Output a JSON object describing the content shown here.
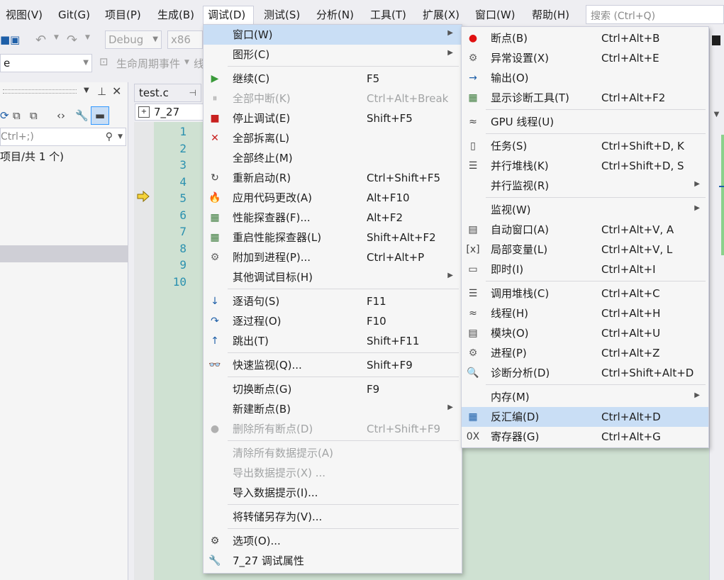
{
  "menubar": {
    "items": [
      "视图(V)",
      "Git(G)",
      "项目(P)",
      "生成(B)",
      "调试(D)",
      "测试(S)",
      "分析(N)",
      "工具(T)",
      "扩展(X)",
      "窗口(W)",
      "帮助(H)"
    ],
    "search_placeholder": "搜索 (Ctrl+Q)"
  },
  "toolbar": {
    "config": "Debug",
    "platform": "x86",
    "left_combo": "e",
    "lifecycle": "生命周期事件",
    "lifecycle_trail": "线"
  },
  "left_panel": {
    "search_placeholder": "Ctrl+;)",
    "solution_text": "项目/共 1 个)"
  },
  "editor": {
    "tab_title": "test.c",
    "tab_pin": "⊣",
    "scope": "7_27",
    "line_numbers": [
      "1",
      "2",
      "3",
      "4",
      "5",
      "6",
      "7",
      "8",
      "9",
      "10"
    ]
  },
  "debug_menu": {
    "items": [
      {
        "icon": "",
        "label": "窗口(W)",
        "shortcut": "",
        "submenu": true
      },
      {
        "icon": "",
        "label": "图形(C)",
        "shortcut": "",
        "submenu": true
      },
      {
        "icon": "▶",
        "label": "继续(C)",
        "shortcut": "F5"
      },
      {
        "icon": "⏸",
        "label": "全部中断(K)",
        "shortcut": "Ctrl+Alt+Break",
        "disabled": true
      },
      {
        "icon": "■",
        "label": "停止调试(E)",
        "shortcut": "Shift+F5"
      },
      {
        "icon": "✕",
        "label": "全部拆离(L)",
        "shortcut": ""
      },
      {
        "icon": "",
        "label": "全部终止(M)",
        "shortcut": ""
      },
      {
        "icon": "↻",
        "label": "重新启动(R)",
        "shortcut": "Ctrl+Shift+F5"
      },
      {
        "icon": "🔥",
        "label": "应用代码更改(A)",
        "shortcut": "Alt+F10"
      },
      {
        "icon": "▦",
        "label": "性能探查器(F)...",
        "shortcut": "Alt+F2"
      },
      {
        "icon": "▦",
        "label": "重启性能探查器(L)",
        "shortcut": "Shift+Alt+F2"
      },
      {
        "icon": "⚙",
        "label": "附加到进程(P)...",
        "shortcut": "Ctrl+Alt+P"
      },
      {
        "icon": "",
        "label": "其他调试目标(H)",
        "shortcut": "",
        "submenu": true
      },
      {
        "icon": "↓",
        "label": "逐语句(S)",
        "shortcut": "F11"
      },
      {
        "icon": "↷",
        "label": "逐过程(O)",
        "shortcut": "F10"
      },
      {
        "icon": "↑",
        "label": "跳出(T)",
        "shortcut": "Shift+F11"
      },
      {
        "icon": "👓",
        "label": "快速监视(Q)...",
        "shortcut": "Shift+F9"
      },
      {
        "icon": "",
        "label": "切换断点(G)",
        "shortcut": "F9"
      },
      {
        "icon": "",
        "label": "新建断点(B)",
        "shortcut": "",
        "submenu": true
      },
      {
        "icon": "●",
        "label": "删除所有断点(D)",
        "shortcut": "Ctrl+Shift+F9",
        "disabled": true
      },
      {
        "icon": "",
        "label": "清除所有数据提示(A)",
        "shortcut": "",
        "disabled": true
      },
      {
        "icon": "",
        "label": "导出数据提示(X) ...",
        "shortcut": "",
        "disabled": true
      },
      {
        "icon": "",
        "label": "导入数据提示(I)...",
        "shortcut": ""
      },
      {
        "icon": "",
        "label": "将转储另存为(V)...",
        "shortcut": ""
      },
      {
        "icon": "⚙",
        "label": "选项(O)...",
        "shortcut": ""
      },
      {
        "icon": "🔧",
        "label": "7_27 调试属性",
        "shortcut": ""
      }
    ]
  },
  "window_submenu": {
    "items": [
      {
        "icon": "●",
        "label": "断点(B)",
        "shortcut": "Ctrl+Alt+B"
      },
      {
        "icon": "⚙",
        "label": "异常设置(X)",
        "shortcut": "Ctrl+Alt+E"
      },
      {
        "icon": "→",
        "label": "输出(O)",
        "shortcut": ""
      },
      {
        "icon": "▦",
        "label": "显示诊断工具(T)",
        "shortcut": "Ctrl+Alt+F2"
      },
      {
        "icon": "≈",
        "label": "GPU 线程(U)",
        "shortcut": ""
      },
      {
        "icon": "▯",
        "label": "任务(S)",
        "shortcut": "Ctrl+Shift+D, K"
      },
      {
        "icon": "☰",
        "label": "并行堆栈(K)",
        "shortcut": "Ctrl+Shift+D, S"
      },
      {
        "icon": "",
        "label": "并行监视(R)",
        "shortcut": "",
        "submenu": true
      },
      {
        "icon": "",
        "label": "监视(W)",
        "shortcut": "",
        "submenu": true
      },
      {
        "icon": "▤",
        "label": "自动窗口(A)",
        "shortcut": "Ctrl+Alt+V, A"
      },
      {
        "icon": "[x]",
        "label": "局部变量(L)",
        "shortcut": "Ctrl+Alt+V, L"
      },
      {
        "icon": "▭",
        "label": "即时(I)",
        "shortcut": "Ctrl+Alt+I"
      },
      {
        "icon": "☰",
        "label": "调用堆栈(C)",
        "shortcut": "Ctrl+Alt+C"
      },
      {
        "icon": "≈",
        "label": "线程(H)",
        "shortcut": "Ctrl+Alt+H"
      },
      {
        "icon": "▤",
        "label": "模块(O)",
        "shortcut": "Ctrl+Alt+U"
      },
      {
        "icon": "⚙",
        "label": "进程(P)",
        "shortcut": "Ctrl+Alt+Z"
      },
      {
        "icon": "🔍",
        "label": "诊断分析(D)",
        "shortcut": "Ctrl+Shift+Alt+D"
      },
      {
        "icon": "",
        "label": "内存(M)",
        "shortcut": "",
        "submenu": true
      },
      {
        "icon": "▦",
        "label": "反汇编(D)",
        "shortcut": "Ctrl+Alt+D",
        "highlighted": true
      },
      {
        "icon": "0X",
        "label": "寄存器(G)",
        "shortcut": "Ctrl+Alt+G"
      }
    ]
  },
  "colors": {
    "highlight": "#c9def5",
    "editor_bg": "#cfe1d2",
    "line_number": "#2b91af"
  }
}
